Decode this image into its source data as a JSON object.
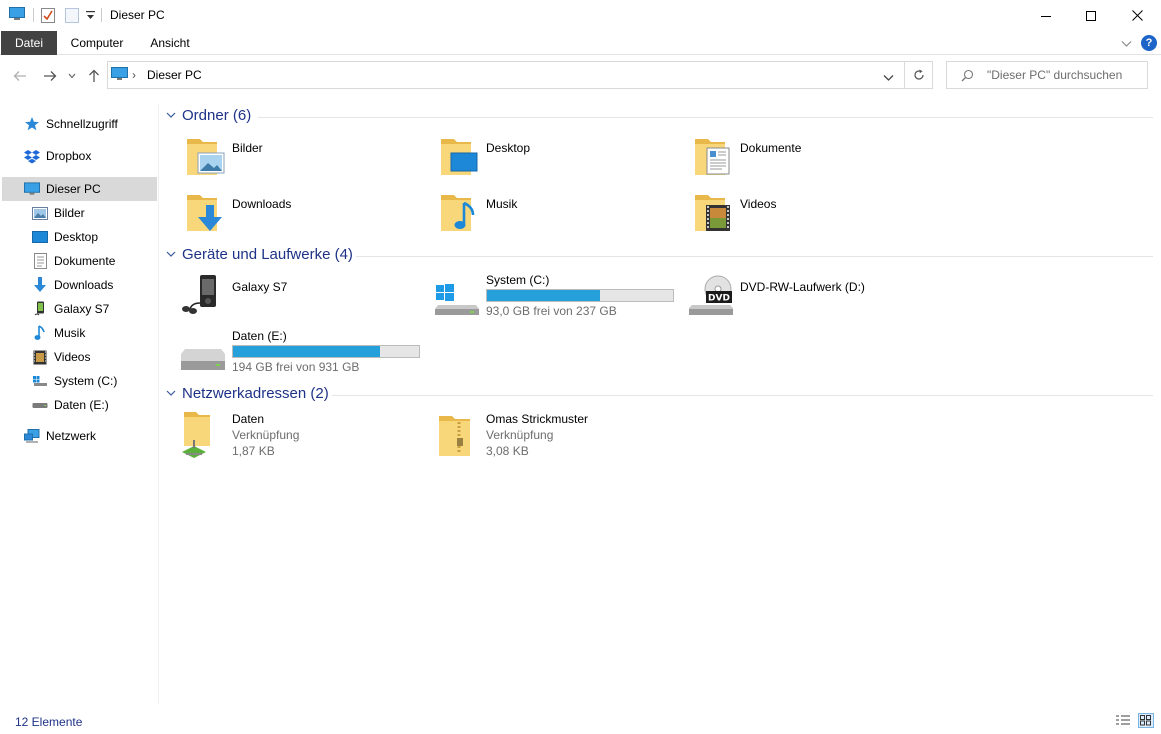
{
  "window": {
    "title": "Dieser PC"
  },
  "ribbon": {
    "tabs": [
      "Datei",
      "Computer",
      "Ansicht"
    ]
  },
  "address": {
    "location": "Dieser PC",
    "separator": "›"
  },
  "search": {
    "placeholder": "\"Dieser PC\" durchsuchen"
  },
  "sidebar": {
    "items": [
      {
        "label": "Schnellzugriff",
        "icon": "star-icon"
      },
      {
        "label": "Dropbox",
        "icon": "dropbox-icon"
      },
      {
        "label": "Dieser PC",
        "icon": "computer-icon",
        "selected": true
      },
      {
        "label": "Bilder",
        "icon": "pictures-icon"
      },
      {
        "label": "Desktop",
        "icon": "desktop-icon"
      },
      {
        "label": "Dokumente",
        "icon": "documents-icon"
      },
      {
        "label": "Downloads",
        "icon": "download-icon"
      },
      {
        "label": "Galaxy S7",
        "icon": "phone-icon"
      },
      {
        "label": "Musik",
        "icon": "music-icon"
      },
      {
        "label": "Videos",
        "icon": "video-icon"
      },
      {
        "label": "System (C:)",
        "icon": "system-drive-icon"
      },
      {
        "label": "Daten (E:)",
        "icon": "drive-icon"
      },
      {
        "label": "Netzwerk",
        "icon": "network-icon"
      }
    ]
  },
  "groups": {
    "folders": {
      "title": "Ordner (6)",
      "items": [
        {
          "name": "Bilder",
          "icon": "pictures-folder-icon"
        },
        {
          "name": "Desktop",
          "icon": "desktop-folder-icon"
        },
        {
          "name": "Dokumente",
          "icon": "documents-folder-icon"
        },
        {
          "name": "Downloads",
          "icon": "downloads-folder-icon"
        },
        {
          "name": "Musik",
          "icon": "music-folder-icon"
        },
        {
          "name": "Videos",
          "icon": "videos-folder-icon"
        }
      ]
    },
    "devices": {
      "title": "Geräte und Laufwerke (4)",
      "items": [
        {
          "name": "Galaxy S7",
          "icon": "media-player-icon"
        },
        {
          "name": "System (C:)",
          "icon": "windows-drive-icon",
          "free": "93,0 GB frei von 237 GB",
          "used_fraction": 0.61
        },
        {
          "name": "DVD-RW-Laufwerk (D:)",
          "icon": "dvd-drive-icon"
        },
        {
          "name": "Daten (E:)",
          "icon": "hard-drive-icon",
          "free": "194 GB frei von 931 GB",
          "used_fraction": 0.79
        }
      ]
    },
    "network": {
      "title": "Netzwerkadressen (2)",
      "items": [
        {
          "name": "Daten",
          "type": "Verknüpfung",
          "size": "1,87 KB",
          "icon": "network-folder-icon"
        },
        {
          "name": "Omas Strickmuster",
          "type": "Verknüpfung",
          "size": "3,08 KB",
          "icon": "zip-folder-icon"
        }
      ]
    }
  },
  "status": {
    "count": "12 Elemente"
  },
  "colors": {
    "accent": "#26a0da",
    "group_heading": "#1e3287",
    "selected": "#d9d9d9"
  }
}
